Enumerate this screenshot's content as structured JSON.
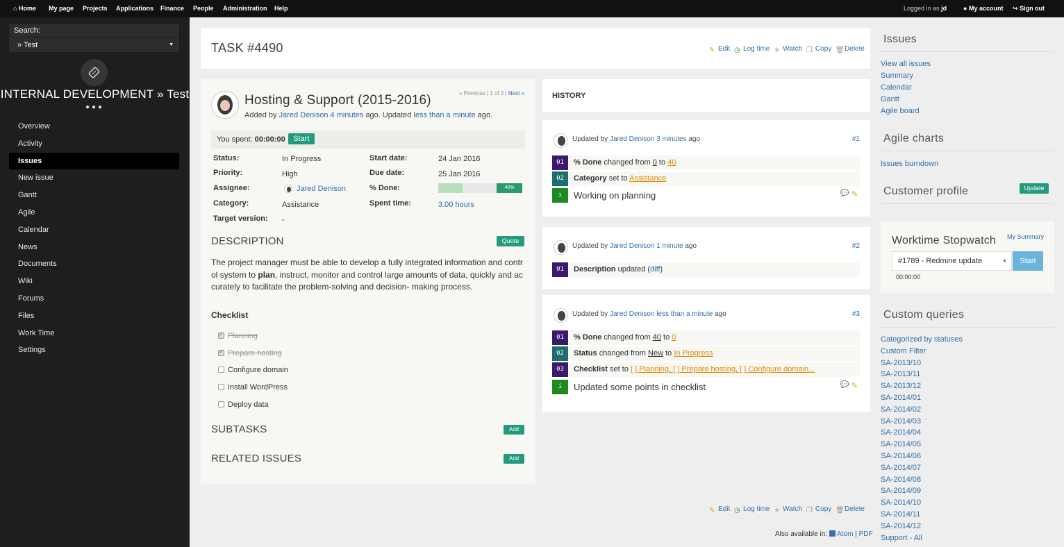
{
  "topbar": {
    "home": "Home",
    "my_page": "My page",
    "projects": "Projects",
    "applications": "Applications",
    "finance": "Finance",
    "people": "People",
    "administration": "Administration",
    "help": "Help",
    "logged_in_prefix": "Logged in as",
    "logged_in_user": "jd",
    "my_account": "My account",
    "sign_out": "Sign out"
  },
  "sidebar": {
    "search_label": "Search:",
    "search_value": "» Test",
    "project_title": "INTERNAL DEVELOPMENT » Test",
    "items": [
      "Overview",
      "Activity",
      "Issues",
      "New issue",
      "Gantt",
      "Agile",
      "Calendar",
      "News",
      "Documents",
      "Wiki",
      "Forums",
      "Files",
      "Work Time",
      "Settings"
    ],
    "active": "Issues"
  },
  "task": {
    "title": "TASK #4490",
    "actions": {
      "edit": "Edit",
      "log_time": "Log time",
      "watch": "Watch",
      "copy": "Copy",
      "delete": "Delete"
    }
  },
  "issue": {
    "subject": "Hosting & Support (2015-2016)",
    "added_by_prefix": "Added by",
    "author": "Jared Denison",
    "created_ago": "4 minutes",
    "ago_updated": "ago. Updated",
    "updated_ago": "less than a minute",
    "ago_end": "ago.",
    "pager": {
      "previous": "« Previous",
      "sep1": "|",
      "position": "1 of 2",
      "sep2": "|",
      "next": "Next »"
    },
    "spent_label": "You spent:",
    "spent_value": "00:00:00",
    "start_button": "Start",
    "status_label": "Status:",
    "status": "In Progress",
    "priority_label": "Priority:",
    "priority": "High",
    "assignee_label": "Assignee:",
    "assignee": "Jared Denison",
    "category_label": "Category:",
    "category": "Assistance",
    "target_label": "Target version:",
    "target": "-",
    "start_date_label": "Start date:",
    "start_date": "24 Jan 2016",
    "due_date_label": "Due date:",
    "due_date": "25 Jan 2016",
    "done_label": "% Done:",
    "done_percent": 40,
    "done_text": "40%",
    "spent_time_label": "Spent time:",
    "spent_time": "3.00 hours",
    "description_heading": "DESCRIPTION",
    "quote_button": "Quote",
    "description_line1": "The project manager must be able to develop a fully integrated information and contr",
    "description_line2_a": "ol system to",
    "description_line2_bold": "plan",
    "description_line2_b": ", instruct, monitor and control large amounts of data, quickly and ac",
    "description_line3": "curately to facilitate the problem-solving and decision- making process.",
    "checklist_heading": "Checklist",
    "checklist": [
      {
        "label": "Planning",
        "done": true
      },
      {
        "label": "Prepare hosting",
        "done": true
      },
      {
        "label": "Configure domain",
        "done": false
      },
      {
        "label": "Install WordPress",
        "done": false
      },
      {
        "label": "Deploy data",
        "done": false
      }
    ],
    "subtasks_heading": "SUBTASKS",
    "related_heading": "RELATED ISSUES",
    "add_button": "Add"
  },
  "history": {
    "title": "HISTORY",
    "updated_by": "Updated by",
    "journals": [
      {
        "author": "Jared Denison",
        "time": "3 minutes",
        "ago": "ago",
        "num": "#1",
        "d1_label": "% Done",
        "d1_mid": "changed from",
        "d1_from": "0",
        "d1_to_word": "to",
        "d1_to": "40",
        "d2_label": "Category",
        "d2_mid": "set to",
        "d2_to": "Assistance",
        "note": "Working on planning"
      },
      {
        "author": "Jared Denison",
        "time": "1 minute",
        "ago": "ago",
        "num": "#2",
        "d1_label": "Description",
        "d1_mid": "updated (",
        "d1_link": "diff",
        "d1_end": ")"
      },
      {
        "author": "Jared Denison",
        "time": "less than a minute",
        "ago": "ago",
        "num": "#3",
        "d1_label": "% Done",
        "d1_mid": "changed from",
        "d1_from": "40",
        "d1_to_word": "to",
        "d1_to": "0",
        "d2_label": "Status",
        "d2_mid": "changed from",
        "d2_from": "New",
        "d2_to_word": "to",
        "d2_to": "In Progress",
        "d3_label": "Checklist",
        "d3_mid": "set to",
        "d3_to": "[ ] Planning, [ ] Prepare hosting, [ ] Configure domain...",
        "note": "Updated some points in checklist"
      }
    ],
    "numbers": [
      "01",
      "02",
      "03",
      "i"
    ]
  },
  "footer": {
    "also_available": "Also available in:",
    "atom": "Atom",
    "sep": "|",
    "pdf": "PDF"
  },
  "right": {
    "issues_heading": "Issues",
    "issues_links": [
      "View all issues",
      "Summary",
      "Calendar",
      "Gantt",
      "Agile board"
    ],
    "agile_heading": "Agile charts",
    "agile_link": "Issues burndown",
    "customer_heading": "Customer profile",
    "update_button": "Update",
    "stopwatch_heading": "Worktime Stopwatch",
    "my_summary": "My Summary",
    "stopwatch_select": "#1789 - Redmine update",
    "stopwatch_start": "Start",
    "stopwatch_time": "00:00:00",
    "queries_heading": "Custom queries",
    "queries": [
      "Categorized by statuses",
      "Custom Filter",
      "SA-2013/10",
      "SA-2013/11",
      "SA-2013/12",
      "SA-2014/01",
      "SA-2014/02",
      "SA-2014/03",
      "SA-2014/04",
      "SA-2014/05",
      "SA-2014/06",
      "SA-2014/07",
      "SA-2014/08",
      "SA-2014/09",
      "SA-2014/10",
      "SA-2014/11",
      "SA-2014/12",
      "Support - All"
    ]
  },
  "colors": {
    "accent_green": "#23997d",
    "link": "#2f6fa8",
    "orange": "#e08b00",
    "sidebar_bg": "#1e1e1e"
  }
}
